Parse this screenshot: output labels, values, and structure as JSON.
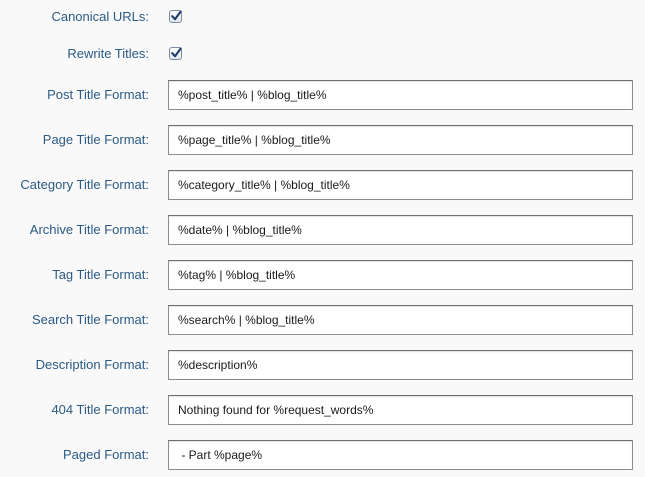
{
  "settings": {
    "canonical_urls": {
      "label": "Canonical URLs:",
      "checked": true
    },
    "rewrite_titles": {
      "label": "Rewrite Titles:",
      "checked": true
    },
    "fields": [
      {
        "label": "Post Title Format:",
        "value": "%post_title% | %blog_title%"
      },
      {
        "label": "Page Title Format:",
        "value": "%page_title% | %blog_title%"
      },
      {
        "label": "Category Title Format:",
        "value": "%category_title% | %blog_title%"
      },
      {
        "label": "Archive Title Format:",
        "value": "%date% | %blog_title%"
      },
      {
        "label": "Tag Title Format:",
        "value": "%tag% | %blog_title%"
      },
      {
        "label": "Search Title Format:",
        "value": "%search% | %blog_title%"
      },
      {
        "label": "Description Format:",
        "value": "%description%"
      },
      {
        "label": "404 Title Format:",
        "value": "Nothing found for %request_words%"
      },
      {
        "label": "Paged Format:",
        "value": " - Part %page%"
      }
    ]
  },
  "colors": {
    "label": "#2b5a84",
    "checkmark": "#1d3b66",
    "background": "#f9f9f9"
  },
  "icons": {
    "checkbox": "checkmark-icon"
  }
}
